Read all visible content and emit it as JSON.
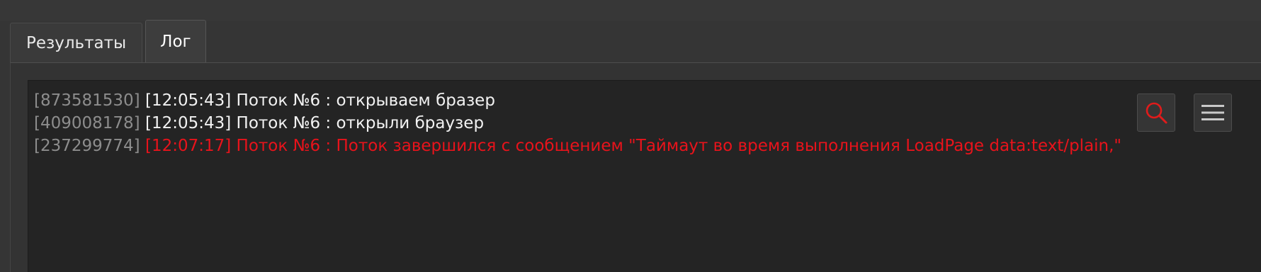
{
  "tabs": [
    {
      "label": "Результаты",
      "active": false
    },
    {
      "label": "Лог",
      "active": true
    }
  ],
  "log": {
    "lines": [
      {
        "id": "[873581530]",
        "text": "[12:05:43] Поток №6 : открываем бразер",
        "level": "info"
      },
      {
        "id": "[409008178]",
        "text": "[12:05:43] Поток №6 : открыли браузер",
        "level": "info"
      },
      {
        "id": "[237299774]",
        "text": "[12:07:17] Поток №6 : Поток завершился с сообщением \"Таймаут во время выполнения LoadPage data:text/plain,\"",
        "level": "error"
      }
    ]
  },
  "toolbar": {
    "search_icon": "search-icon",
    "menu_icon": "hamburger-menu-icon"
  },
  "colors": {
    "background": "#353535",
    "log_background": "#242424",
    "error_text": "#e8131b",
    "id_text": "#8d8d8d",
    "normal_text": "#f2f2f2"
  }
}
